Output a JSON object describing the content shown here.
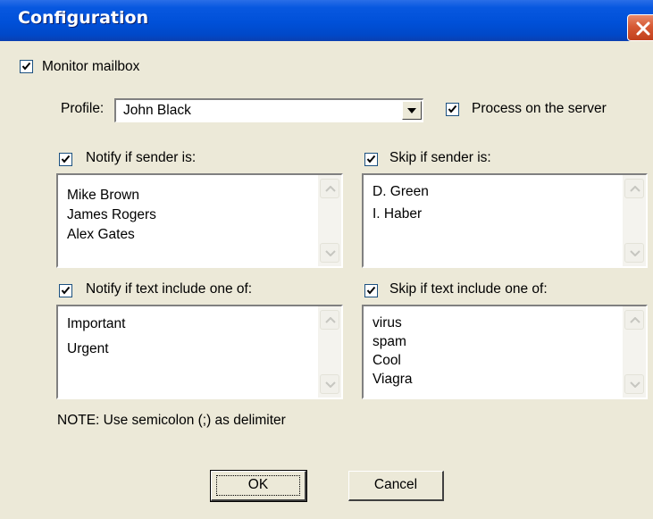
{
  "window": {
    "title": "Configuration",
    "close_icon": "close-icon"
  },
  "monitor_mailbox": {
    "label": "Monitor mailbox",
    "checked": true
  },
  "profile": {
    "label": "Profile:",
    "value": "John Black",
    "dropdown_icon": "chevron-down-icon"
  },
  "process_on_server": {
    "label": "Process on the server",
    "checked": true
  },
  "notify_sender": {
    "label": "Notify if sender is:",
    "checked": true,
    "items": [
      "Mike Brown",
      "James Rogers",
      "Alex Gates"
    ]
  },
  "skip_sender": {
    "label": "Skip if sender is:",
    "checked": true,
    "items": [
      "D. Green",
      "I. Haber"
    ]
  },
  "notify_text": {
    "label": "Notify if text include one of:",
    "checked": true,
    "items": [
      "Important",
      "Urgent"
    ]
  },
  "skip_text": {
    "label": "Skip if text include one of:",
    "checked": true,
    "items": [
      "virus",
      "spam",
      "Cool",
      "Viagra"
    ]
  },
  "note": "NOTE: Use semicolon (;) as delimiter",
  "buttons": {
    "ok": "OK",
    "cancel": "Cancel"
  },
  "colors": {
    "titlebar": "#0050d8",
    "dialog_bg": "#ece9d8",
    "close_button": "#d65a35",
    "checkbox_border": "#1c5180"
  }
}
